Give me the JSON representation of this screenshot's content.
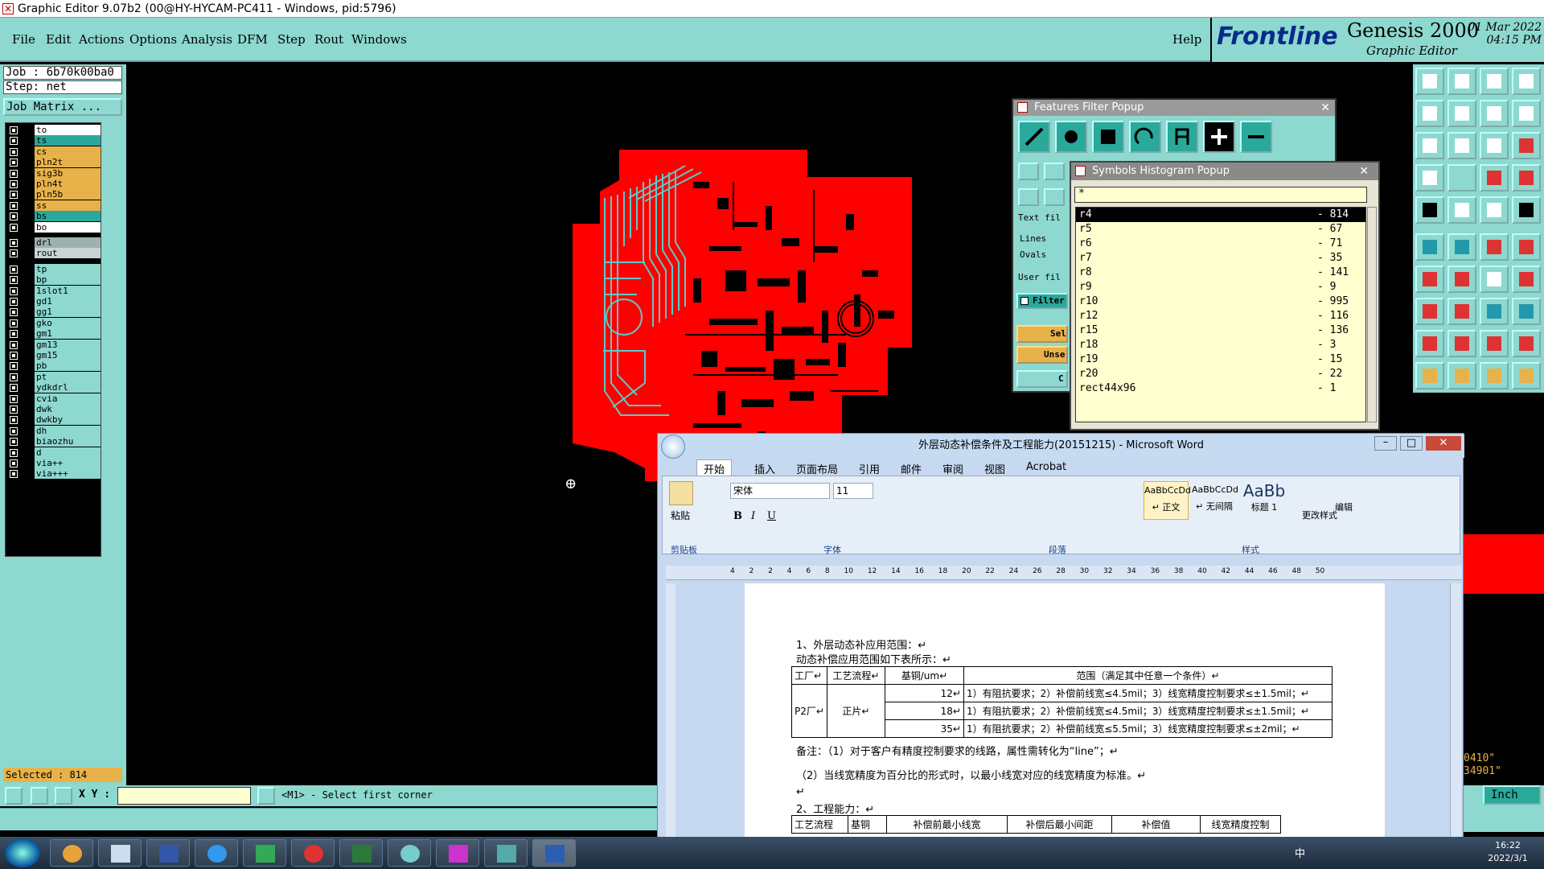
{
  "window": {
    "title": "Graphic Editor 9.07b2 (00@HY-HYCAM-PC411 - Windows, pid:5796)"
  },
  "menu": [
    "File",
    "Edit",
    "Actions",
    "Options",
    "Analysis",
    "DFM",
    "Step",
    "Rout",
    "Windows"
  ],
  "help": "Help",
  "brand": {
    "logo": "Frontline",
    "product": "Genesis 2000",
    "subtitle": "Graphic Editor",
    "date": "01 Mar 2022",
    "time": "04:15 PM"
  },
  "job": {
    "job_line": "Job : 6b70k00ba0",
    "step_line": "Step: net",
    "matrix_button": "Job Matrix ..."
  },
  "layers": [
    {
      "name": "to",
      "color": "#ffffff"
    },
    {
      "name": "ts",
      "color": "#2aa89a"
    },
    {
      "name": "cs",
      "color": "#e8b24a"
    },
    {
      "name": "pln2t",
      "color": "#e8b24a"
    },
    {
      "name": "sig3b",
      "color": "#e8b24a"
    },
    {
      "name": "pln4t",
      "color": "#e8b24a"
    },
    {
      "name": "pln5b",
      "color": "#e8b24a"
    },
    {
      "name": "ss",
      "color": "#e8b24a"
    },
    {
      "name": "bs",
      "color": "#2aa89a"
    },
    {
      "name": "bo",
      "color": "#ffffff"
    },
    {
      "name": "drl",
      "color": "#9fb0b0"
    },
    {
      "name": "rout",
      "color": "#c8d4d4"
    },
    {
      "name": "tp",
      "color": "#8dd8cf"
    },
    {
      "name": "bp",
      "color": "#8dd8cf"
    },
    {
      "name": "1slot1",
      "color": "#8dd8cf"
    },
    {
      "name": "gd1",
      "color": "#8dd8cf"
    },
    {
      "name": "gg1",
      "color": "#8dd8cf"
    },
    {
      "name": "gko",
      "color": "#8dd8cf"
    },
    {
      "name": "gm1",
      "color": "#8dd8cf"
    },
    {
      "name": "gm13",
      "color": "#8dd8cf"
    },
    {
      "name": "gm15",
      "color": "#8dd8cf"
    },
    {
      "name": "pb",
      "color": "#8dd8cf"
    },
    {
      "name": "pt",
      "color": "#8dd8cf"
    },
    {
      "name": "ydkdrl",
      "color": "#8dd8cf"
    },
    {
      "name": "cvia",
      "color": "#8dd8cf"
    },
    {
      "name": "dwk",
      "color": "#8dd8cf"
    },
    {
      "name": "dwkby",
      "color": "#8dd8cf"
    },
    {
      "name": "dh",
      "color": "#8dd8cf"
    },
    {
      "name": "biaozhu",
      "color": "#8dd8cf"
    },
    {
      "name": "d",
      "color": "#8dd8cf"
    },
    {
      "name": "via++",
      "color": "#8dd8cf"
    },
    {
      "name": "via+++",
      "color": "#8dd8cf"
    }
  ],
  "status": {
    "selected": "Selected : 814",
    "xy_label": "X Y :",
    "prompt": "<M1> - Select first corner",
    "unit": "Inch",
    "coord1": "0410\"",
    "coord2": "34901\""
  },
  "features_filter": {
    "title": "Features Filter Popup",
    "text_filter": "Text fil",
    "lines": "Lines",
    "ovals": "Ovals",
    "user_filter": "User fil",
    "filter": "Filter",
    "select": "Sel",
    "unselect": "Unse",
    "close": "C"
  },
  "symbols_histogram": {
    "title": "Symbols Histogram Popup",
    "filter": "*",
    "rows": [
      {
        "sym": "r4",
        "count": "814"
      },
      {
        "sym": "r5",
        "count": "67"
      },
      {
        "sym": "r6",
        "count": "71"
      },
      {
        "sym": "r7",
        "count": "35"
      },
      {
        "sym": "r8",
        "count": "141"
      },
      {
        "sym": "r9",
        "count": "9"
      },
      {
        "sym": "r10",
        "count": "995"
      },
      {
        "sym": "r12",
        "count": "116"
      },
      {
        "sym": "r15",
        "count": "136"
      },
      {
        "sym": "r18",
        "count": "3"
      },
      {
        "sym": "r19",
        "count": "15"
      },
      {
        "sym": "r20",
        "count": "22"
      },
      {
        "sym": "rect44x96",
        "count": "1"
      }
    ]
  },
  "word": {
    "title": "外层动态补偿条件及工程能力(20151215) - Microsoft Word",
    "tabs": [
      "开始",
      "插入",
      "页面布局",
      "引用",
      "邮件",
      "审阅",
      "视图",
      "Acrobat"
    ],
    "font_name": "宋体",
    "font_size": "11",
    "paste": "粘贴",
    "groups": [
      "剪贴板",
      "字体",
      "段落",
      "样式"
    ],
    "styles": [
      {
        "sample": "AaBbCcDd",
        "name": "↵ 正文"
      },
      {
        "sample": "AaBbCcDd",
        "name": "↵ 无间隔"
      },
      {
        "sample": "AaBb",
        "name": "标题 1"
      }
    ],
    "change_styles": "更改样式",
    "edit": "编辑",
    "ruler": "4 2 2 4 6 8 10 12 14 16 18 20 22 24 26 28 30 32 34 36 38 40 42 44 46 48 50",
    "doc": {
      "h1": "1、外层动态补应用范围：↵",
      "p1": "动态补偿应用范围如下表所示：↵",
      "table_head": [
        "工厂↵",
        "工艺流程↵",
        "基铜/um↵",
        "范围（满足其中任意一个条件）↵"
      ],
      "factory": "P2厂↵",
      "process": "正片↵",
      "rows": [
        {
          "cu": "12↵",
          "range": "1）有阻抗要求；2）补偿前线宽≤4.5mil；3）线宽精度控制要求≤±1.5mil；↵"
        },
        {
          "cu": "18↵",
          "range": "1）有阻抗要求；2）补偿前线宽≤4.5mil；3）线宽精度控制要求≤±1.5mil；↵"
        },
        {
          "cu": "35↵",
          "range": "1）有阻抗要求；2）补偿前线宽≤5.5mil；3）线宽精度控制要求≤±2mil；↵"
        }
      ],
      "note1": "备注：（1）对于客户有精度控制要求的线路，属性需转化为“line”；↵",
      "note2": "（2）当线宽精度为百分比的形式时，以最小线宽对应的线宽精度为标准。↵",
      "blank": "↵",
      "h2": "2、工程能力：↵",
      "table2_head": [
        "工艺流程",
        "基铜",
        "补偿前最小线宽",
        "补偿后最小间距",
        "补偿值",
        "线宽精度控制"
      ]
    }
  },
  "taskbar": {
    "time": "16:22",
    "date": "2022/3/1",
    "ime": "中"
  }
}
